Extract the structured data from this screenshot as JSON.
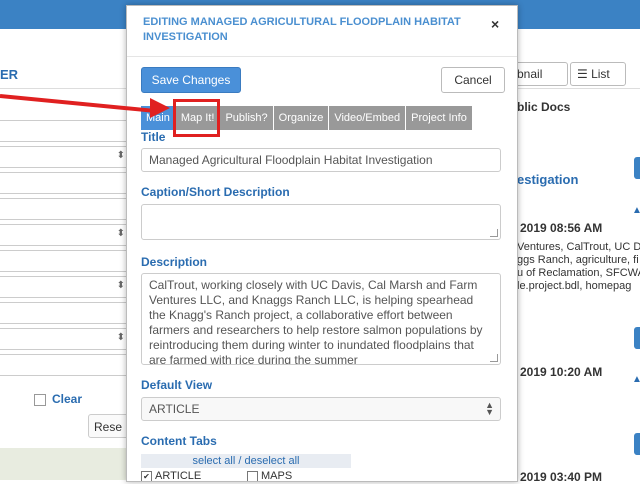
{
  "modal": {
    "title": "EDITING MANAGED AGRICULTURAL FLOODPLAIN HABITAT INVESTIGATION",
    "close_icon": "×",
    "save_label": "Save Changes",
    "cancel_label": "Cancel",
    "tabs": [
      "Main",
      "Map It!",
      "Publish?",
      "Organize",
      "Video/Embed",
      "Project Info"
    ],
    "active_tab": "Main",
    "highlighted_tab": "Map It!",
    "fields": {
      "title_label": "Title",
      "title_value": "Managed Agricultural Floodplain Habitat Investigation",
      "caption_label": "Caption/Short Description",
      "caption_value": "",
      "description_label": "Description",
      "description_value": "CalTrout, working closely with UC Davis, Cal Marsh and Farm Ventures LLC, and Knaggs Ranch LLC, is helping spearhead the Knagg's Ranch project, a collaborative effort between farmers and researchers to help restore salmon populations by reintroducing them during winter to inundated floodplains that are farmed with rice during the summer",
      "default_view_label": "Default View",
      "default_view_value": "ARTICLE",
      "content_tabs_label": "Content Tabs",
      "select_all": "select all",
      "separator": "/",
      "deselect_all": "deselect all",
      "checkboxes": [
        {
          "label": "ARTICLE",
          "checked": true
        },
        {
          "label": "MAPS",
          "checked": false
        }
      ]
    }
  },
  "background": {
    "left_title": "ER",
    "clear_label": "Clear",
    "reset_label": "Rese",
    "thumbnail_label": "bnail",
    "list_label": "List",
    "public_docs": "blic Docs",
    "investigation": "estigation",
    "date1": "2019 08:56 AM",
    "text_lines": [
      " Ventures, CalTrout, UC D",
      "ggs Ranch, agriculture, fi",
      "u of Reclamation, SFCWA",
      "le.project.bdl, homepag"
    ],
    "date2": "2019 10:20 AM",
    "date3": "2019 03:40 PM"
  },
  "annotation": {
    "color": "#e02020"
  }
}
